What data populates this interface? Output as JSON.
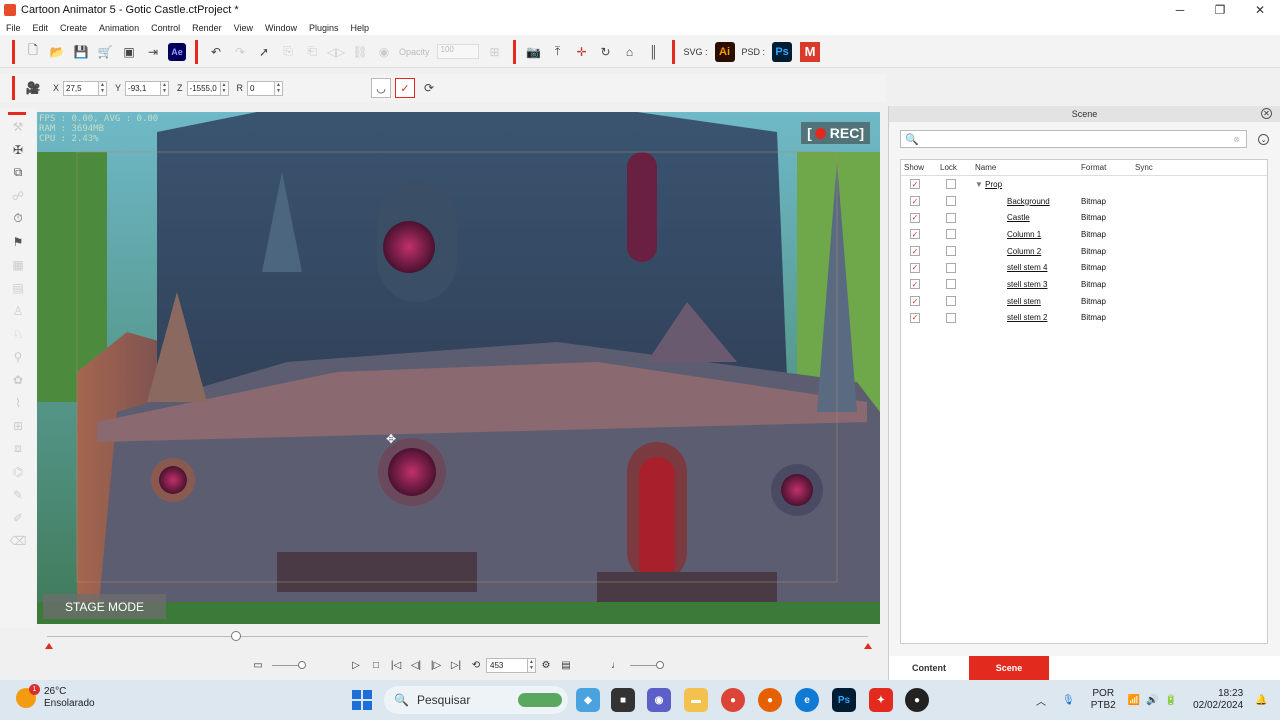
{
  "window": {
    "title": "Cartoon Animator 5 - Gotic Castle.ctProject *",
    "minimize": "─",
    "maximize": "❐",
    "close": "✕"
  },
  "menu": [
    "File",
    "Edit",
    "Create",
    "Animation",
    "Control",
    "Render",
    "View",
    "Window",
    "Plugins",
    "Help"
  ],
  "toolbar": {
    "opacity_label": "Opacity",
    "opacity_value": "100",
    "svg_label": "SVG :",
    "psd_label": "PSD :",
    "ae_label": "Ae",
    "ai_label": "Ai",
    "ps_label": "Ps",
    "m_label": "M"
  },
  "transform": {
    "x_label": "X",
    "x_value": "27,5",
    "y_label": "Y",
    "y_value": "-93,1",
    "z_label": "Z",
    "z_value": "-1555,0",
    "r_label": "R",
    "r_value": "0"
  },
  "stage": {
    "stats": "FPS : 0.00, AVG : 0.00\nRAM : 3694MB\nCPU : 2.43%",
    "rec_label": "REC",
    "mode_label": "STAGE MODE"
  },
  "playback": {
    "frame_value": "453"
  },
  "scene_panel": {
    "title": "Scene",
    "search_placeholder": "",
    "columns": {
      "show": "Show",
      "lock": "Lock",
      "name": "Name",
      "format": "Format",
      "sync": "Sync"
    },
    "group": {
      "name": "Prop",
      "show": true,
      "lock": false
    },
    "rows": [
      {
        "name": "Background",
        "format": "Bitmap",
        "show": true,
        "lock": false
      },
      {
        "name": "Castle",
        "format": "Bitmap",
        "show": true,
        "lock": false
      },
      {
        "name": "Column 1",
        "format": "Bitmap",
        "show": true,
        "lock": false
      },
      {
        "name": "Column 2",
        "format": "Bitmap",
        "show": true,
        "lock": false
      },
      {
        "name": "stell stem 4",
        "format": "Bitmap",
        "show": true,
        "lock": false
      },
      {
        "name": "stell stem 3",
        "format": "Bitmap",
        "show": true,
        "lock": false
      },
      {
        "name": "stell stem",
        "format": "Bitmap",
        "show": true,
        "lock": false
      },
      {
        "name": "stell stem 2",
        "format": "Bitmap",
        "show": true,
        "lock": false
      }
    ],
    "tabs": {
      "content": "Content",
      "scene": "Scene"
    }
  },
  "taskbar": {
    "weather_temp": "26°C",
    "weather_desc": "Ensolarado",
    "weather_badge": "1",
    "search_label": "Pesquisar",
    "lang_line1": "POR",
    "lang_line2": "PTB2",
    "time": "18:23",
    "date": "02/02/2024"
  },
  "colors": {
    "accent": "#e22a1f",
    "stage_bg": "#2a3b50"
  }
}
